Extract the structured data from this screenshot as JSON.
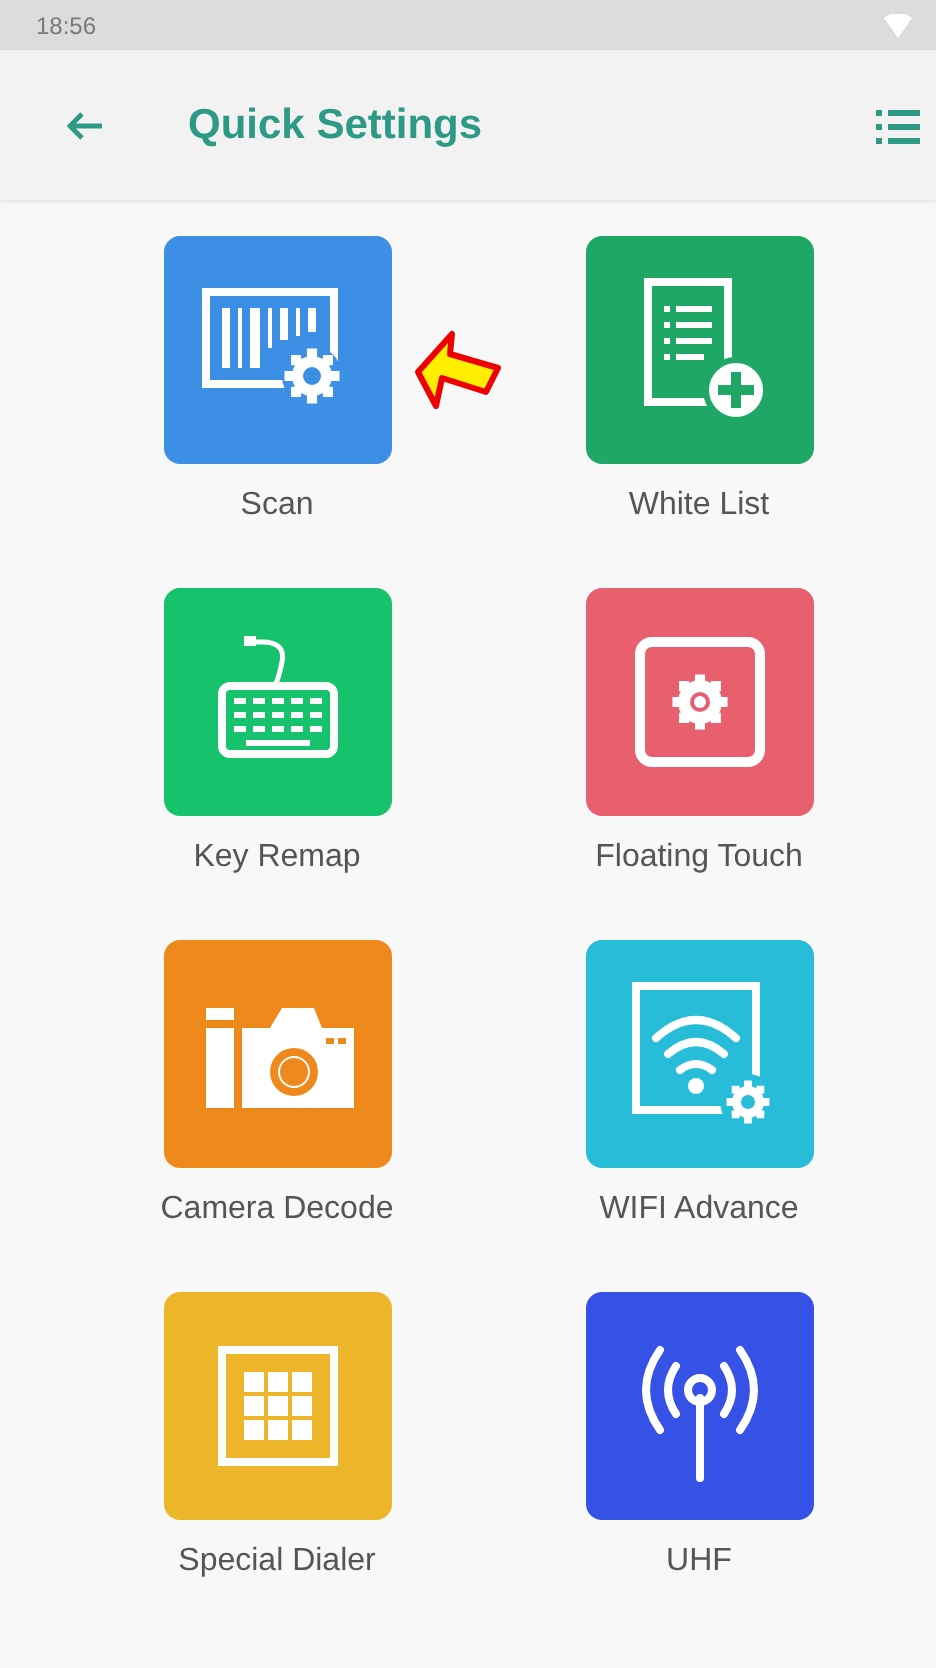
{
  "status_bar": {
    "time": "18:56"
  },
  "app_bar": {
    "title": "Quick Settings"
  },
  "tiles": [
    {
      "label": "Scan",
      "kind": "scan",
      "color": "#3d8fe6",
      "pointed": true
    },
    {
      "label": "White List",
      "kind": "whitelist",
      "color": "#1fa765",
      "pointed": false
    },
    {
      "label": "Key Remap",
      "kind": "keyboard",
      "color": "#17c26c",
      "pointed": false
    },
    {
      "label": "Floating Touch",
      "kind": "floating",
      "color": "#e8606e",
      "pointed": false
    },
    {
      "label": "Camera Decode",
      "kind": "camera",
      "color": "#f0891c",
      "pointed": false
    },
    {
      "label": "WIFI Advance",
      "kind": "wifi",
      "color": "#27bcd8",
      "pointed": false
    },
    {
      "label": "Special Dialer",
      "kind": "dialer",
      "color": "#edb52a",
      "pointed": false
    },
    {
      "label": "UHF",
      "kind": "uhf",
      "color": "#3551e6",
      "pointed": false
    }
  ]
}
